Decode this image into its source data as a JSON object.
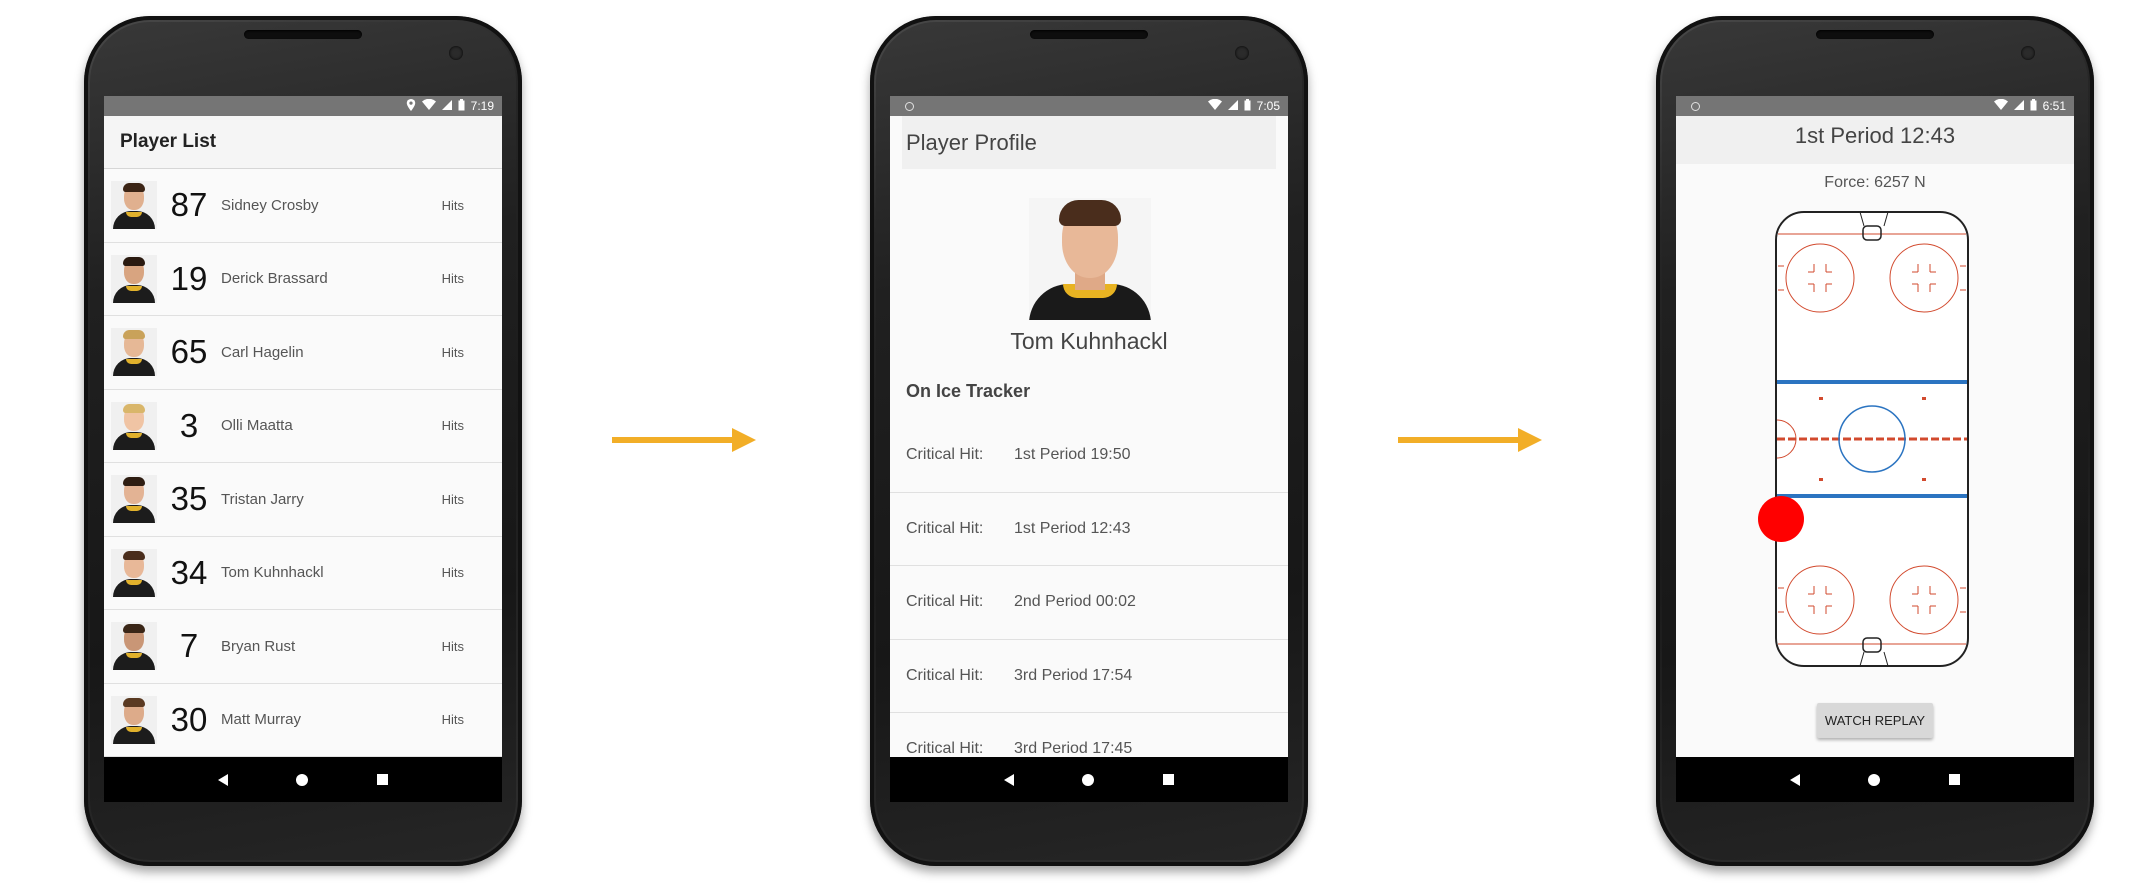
{
  "arrow_color": "#f2ae27",
  "screens": {
    "player_list": {
      "status_time": "7:19",
      "title": "Player List",
      "players": [
        {
          "number": "87",
          "name": "Sidney Crosby",
          "action": "Hits"
        },
        {
          "number": "19",
          "name": "Derick Brassard",
          "action": "Hits"
        },
        {
          "number": "65",
          "name": "Carl Hagelin",
          "action": "Hits"
        },
        {
          "number": "3",
          "name": "Olli Maatta",
          "action": "Hits"
        },
        {
          "number": "35",
          "name": "Tristan Jarry",
          "action": "Hits"
        },
        {
          "number": "34",
          "name": "Tom Kuhnhackl",
          "action": "Hits"
        },
        {
          "number": "7",
          "name": "Bryan Rust",
          "action": "Hits"
        },
        {
          "number": "30",
          "name": "Matt Murray",
          "action": "Hits"
        }
      ]
    },
    "player_profile": {
      "status_time": "7:05",
      "title": "Player Profile",
      "player_name": "Tom Kuhnhackl",
      "section_title": "On Ice Tracker",
      "hits": [
        {
          "label": "Critical Hit:",
          "time": "1st Period 19:50"
        },
        {
          "label": "Critical Hit:",
          "time": "1st Period 12:43"
        },
        {
          "label": "Critical Hit:",
          "time": "2nd Period 00:02"
        },
        {
          "label": "Critical Hit:",
          "time": "3rd Period 17:54"
        },
        {
          "label": "Critical Hit:",
          "time": "3rd Period 17:45"
        }
      ]
    },
    "hit_detail": {
      "status_time": "6:51",
      "title": "1st Period 12:43",
      "force": "Force: 6257 N",
      "replay_button": "WATCH REPLAY",
      "marker_color": "#ff0000"
    }
  }
}
